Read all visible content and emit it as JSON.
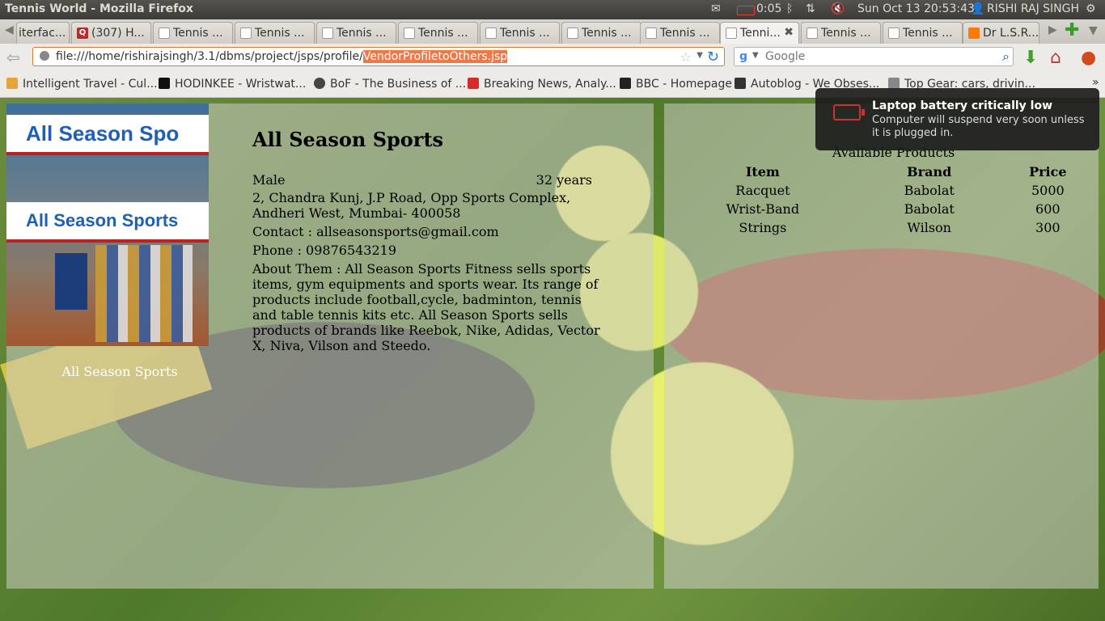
{
  "panel": {
    "window_title": "Tennis World - Mozilla Firefox",
    "battery": "0:05",
    "datetime": "Sun Oct 13 20:53:43",
    "user": "RISHI RAJ SINGH"
  },
  "tabs": [
    {
      "label": "iterfac..."
    },
    {
      "label": "(307) H..."
    },
    {
      "label": "Tennis ..."
    },
    {
      "label": "Tennis ..."
    },
    {
      "label": "Tennis ..."
    },
    {
      "label": "Tennis ..."
    },
    {
      "label": "Tennis ..."
    },
    {
      "label": "Tennis ..."
    },
    {
      "label": "Tennis ..."
    },
    {
      "label": "Tenni..."
    },
    {
      "label": "Tennis ..."
    },
    {
      "label": "Tennis ..."
    },
    {
      "label": "Dr L.S.R..."
    }
  ],
  "address": {
    "url_prefix": "file:///home/rishirajsingh/3.1/dbms/project/jsps/profile/",
    "url_selected": "VendorProfiletoOthers.jsp"
  },
  "search": {
    "placeholder": "Google"
  },
  "bookmarks": [
    {
      "label": "Intelligent Travel - Cul...",
      "color": "#e8a33a"
    },
    {
      "label": "HODINKEE - Wristwat...",
      "color": "#111111"
    },
    {
      "label": "BoF - The Business of ...",
      "color": "#444444"
    },
    {
      "label": "Breaking News, Analy...",
      "color": "#d62b2b"
    },
    {
      "label": "BBC - Homepage",
      "color": "#222222"
    },
    {
      "label": "Autoblog - We Obses...",
      "color": "#333333"
    },
    {
      "label": "Top Gear: cars, drivin...",
      "color": "#888888"
    }
  ],
  "vendor": {
    "photo_sign": "All Season Spo",
    "photo_sign_2": "All Season Sports",
    "caption": "All Season Sports",
    "name": "All Season Sports",
    "gender": "Male",
    "age": "32 years",
    "address": "2, Chandra Kunj, J.P Road, Opp Sports Complex, Andheri West, Mumbai- 400058",
    "contact": "Contact : allseasonsports@gmail.com",
    "phone": "Phone : 09876543219",
    "about": "About Them : All Season Sports Fitness sells sports items, gym equipments and sports wear. Its range of products include football,cycle, badminton, tennis and table tennis kits etc. All Season Sports sells products of brands like Reebok, Nike, Adidas, Vector X, Niva, Vilson and Steedo."
  },
  "products": {
    "title": "Available Products",
    "headers": [
      "Item",
      "Brand",
      "Price"
    ],
    "rows": [
      [
        "Racquet",
        "Babolat",
        "5000"
      ],
      [
        "Wrist-Band",
        "Babolat",
        "600"
      ],
      [
        "Strings",
        "Wilson",
        "300"
      ]
    ]
  },
  "notification": {
    "title": "Laptop battery critically low",
    "message": "Computer will suspend very soon unless it is plugged in."
  }
}
